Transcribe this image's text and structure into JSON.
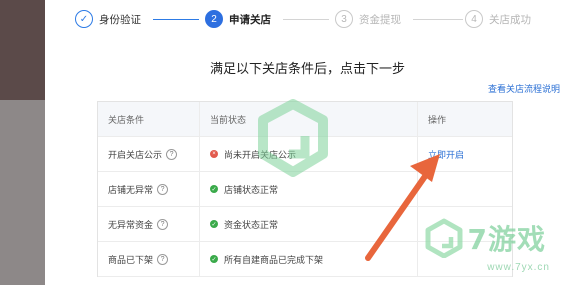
{
  "steps": [
    {
      "num": "✓",
      "label": "身份验证",
      "state": "done"
    },
    {
      "num": "2",
      "label": "申请关店",
      "state": "active"
    },
    {
      "num": "3",
      "label": "资金提现",
      "state": "todo"
    },
    {
      "num": "4",
      "label": "关店成功",
      "state": "todo"
    }
  ],
  "page": {
    "title": "满足以下关店条件后，点击下一步",
    "guide_link": "查看关店流程说明"
  },
  "table": {
    "headers": [
      "关店条件",
      "当前状态",
      "操作"
    ],
    "rows": [
      {
        "condition": "开启关店公示",
        "help": "?",
        "status": "尚未开启关店公示",
        "status_type": "error",
        "action": "立即开启"
      },
      {
        "condition": "店铺无异常",
        "help": "?",
        "status": "店铺状态正常",
        "status_type": "ok",
        "action": ""
      },
      {
        "condition": "无异常资金",
        "help": "?",
        "status": "资金状态正常",
        "status_type": "ok",
        "action": ""
      },
      {
        "condition": "商品已下架",
        "help": "?",
        "status": "所有自建商品已完成下架",
        "status_type": "ok",
        "action": ""
      }
    ]
  },
  "watermark": {
    "brand": "7游戏",
    "url": "www.7yx.cn"
  },
  "colors": {
    "accent": "#2d6fe0",
    "error": "#e25a4d",
    "ok": "#3aaa4a",
    "arrow": "#e8663c"
  }
}
